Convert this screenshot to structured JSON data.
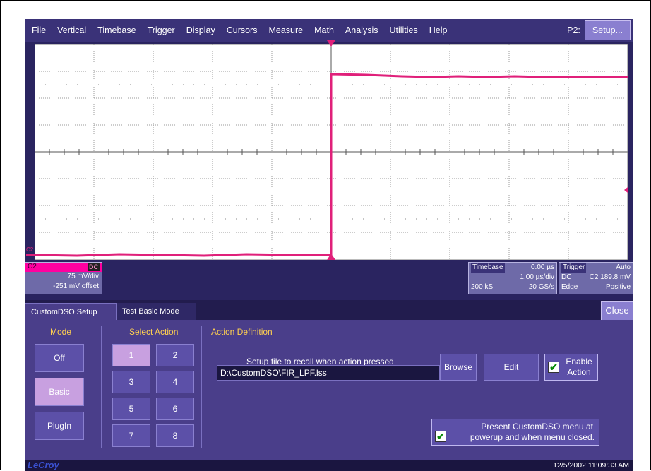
{
  "menu": {
    "items": [
      "File",
      "Vertical",
      "Timebase",
      "Trigger",
      "Display",
      "Cursors",
      "Measure",
      "Math",
      "Analysis",
      "Utilities",
      "Help"
    ],
    "p2_label": "P2:",
    "setup_label": "Setup..."
  },
  "channel": {
    "name": "C2",
    "coupling": "DC",
    "volts_per_div": "75 mV/div",
    "offset": "-251 mV offset",
    "color": "#e0207a"
  },
  "timebase": {
    "title": "Timebase",
    "delay": "0.00 µs",
    "time_per_div": "1.00 µs/div",
    "samples": "200 kS",
    "sample_rate": "20 GS/s"
  },
  "trigger": {
    "title": "Trigger",
    "mode": "Auto",
    "coupling": "DC",
    "level": "C2 189.8 mV",
    "type": "Edge",
    "slope": "Positive"
  },
  "tabs": {
    "active": "CustomDSO Setup",
    "second": "Test Basic Mode",
    "close": "Close"
  },
  "mode": {
    "title": "Mode",
    "options": [
      "Off",
      "Basic",
      "PlugIn"
    ],
    "selected": "Basic"
  },
  "select_action": {
    "title": "Select Action",
    "buttons": [
      "1",
      "2",
      "3",
      "4",
      "5",
      "6",
      "7",
      "8"
    ],
    "selected": "1"
  },
  "action_definition": {
    "title": "Action Definition",
    "caption": "Setup file to recall when action pressed",
    "path": "D:\\CustomDSO\\FIR_LPF.lss",
    "browse": "Browse",
    "edit": "Edit",
    "enable_label_1": "Enable",
    "enable_label_2": "Action",
    "enable_checked": true
  },
  "present_option": {
    "line1": "Present CustomDSO menu at",
    "line2": "powerup and when menu closed.",
    "checked": true
  },
  "status": {
    "logo": "LeCroy",
    "datetime": "12/5/2002 11:09:33 AM"
  }
}
